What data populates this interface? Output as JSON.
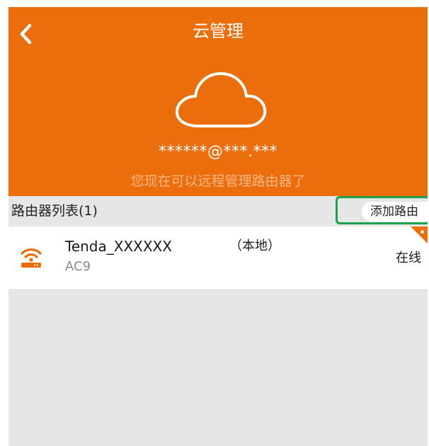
{
  "header": {
    "title": "云管理",
    "account": "******@***.***",
    "subtitle": "您现在可以远程管理路由器了",
    "back_icon": "chevron-left-icon",
    "cloud_icon": "cloud-icon"
  },
  "router_list": {
    "title": "路由器列表(1)",
    "add_button_label": "添加路由",
    "items": [
      {
        "name": "Tenda_XXXXXX",
        "tag": "（本地）",
        "model": "AC9",
        "status": "在线",
        "icon": "router-wifi-icon"
      }
    ]
  },
  "colors": {
    "accent": "#ec6d0c",
    "subtitle": "#f9b884",
    "background": "#e6e6e6",
    "highlight": "#1aa34a"
  }
}
